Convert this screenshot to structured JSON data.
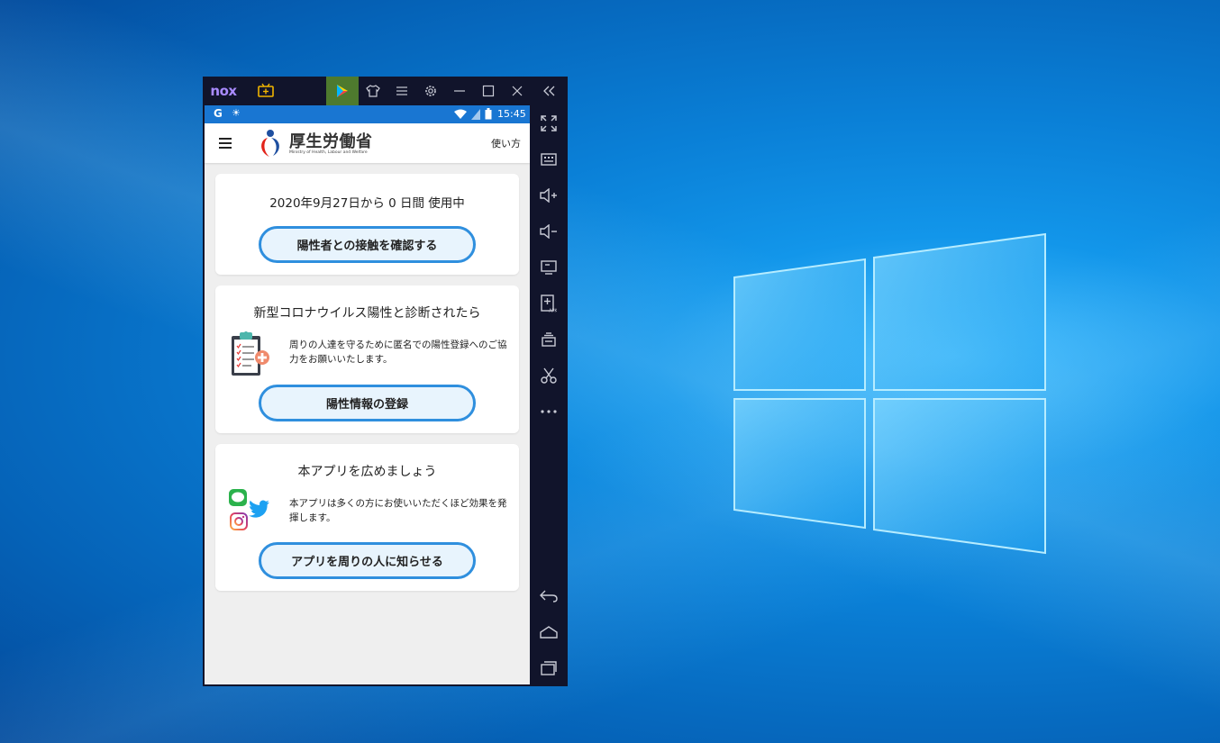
{
  "emulator": {
    "brand": "nox"
  },
  "statusbar": {
    "time": "15:45"
  },
  "appbar": {
    "ministry_name": "厚生労働省",
    "ministry_english": "Ministry of Health, Labour and Welfare",
    "help_label": "使い方"
  },
  "usage_card": {
    "usage_text": "2020年9月27日から 0 日間 使用中",
    "check_button": "陽性者との接触を確認する"
  },
  "positive_card": {
    "title": "新型コロナウイルス陽性と診断されたら",
    "description": "周りの人達を守るために匿名での陽性登録へのご協力をお願いいたします。",
    "register_button": "陽性情報の登録"
  },
  "share_card": {
    "title": "本アプリを広めましょう",
    "description": "本アプリは多くの方にお使いいただくほど効果を発揮します。",
    "share_button": "アプリを周りの人に知らせる",
    "line_label": "LINE"
  },
  "colors": {
    "accent": "#2f8fde",
    "statusbar": "#1976d2",
    "emulator_frame": "#11142b",
    "play_button": "#4e7a2e"
  }
}
